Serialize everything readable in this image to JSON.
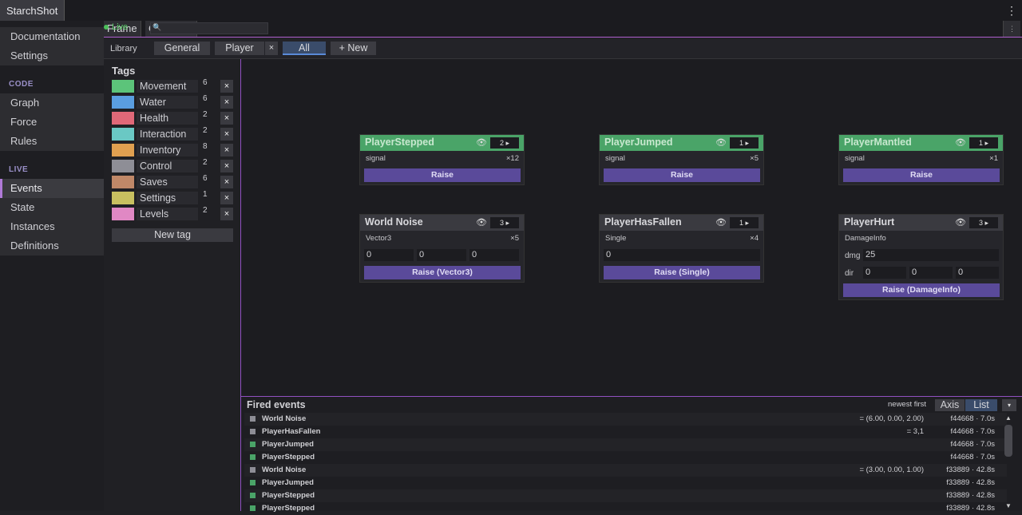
{
  "app": {
    "title": "StarchShot",
    "menu_icon": "⋮"
  },
  "sidebar": {
    "top_items": [
      {
        "label": "Documentation"
      },
      {
        "label": "Settings"
      }
    ],
    "code_header": "CODE",
    "code_items": [
      {
        "label": "Graph"
      },
      {
        "label": "Force"
      },
      {
        "label": "Rules"
      }
    ],
    "live_header": "LIVE",
    "live_items": [
      {
        "label": "Events",
        "active": true
      },
      {
        "label": "State"
      },
      {
        "label": "Instances"
      },
      {
        "label": "Definitions"
      }
    ]
  },
  "toolbar": {
    "frame_label": "Frame",
    "clear_log_label": "Clear Log",
    "live_label": "Live",
    "search_icon": "🔍",
    "search_placeholder": "",
    "menu_icon": "⋮"
  },
  "library": {
    "label": "Library",
    "tabs": [
      {
        "label": "General"
      },
      {
        "label": "Player"
      },
      {
        "label": "All",
        "active": true
      }
    ],
    "close_icon": "×",
    "new_label": "+ New"
  },
  "tags": {
    "title": "Tags",
    "items": [
      {
        "name": "Movement",
        "count": "6",
        "color": "#5cc47a"
      },
      {
        "name": "Water",
        "count": "6",
        "color": "#5a9ee0"
      },
      {
        "name": "Health",
        "count": "2",
        "color": "#e06878"
      },
      {
        "name": "Interaction",
        "count": "2",
        "color": "#6ac8c4"
      },
      {
        "name": "Inventory",
        "count": "8",
        "color": "#e0a050"
      },
      {
        "name": "Control",
        "count": "2",
        "color": "#8e8e96"
      },
      {
        "name": "Saves",
        "count": "6",
        "color": "#c08868"
      },
      {
        "name": "Settings",
        "count": "1",
        "color": "#c8c060"
      },
      {
        "name": "Levels",
        "count": "2",
        "color": "#e088c4"
      }
    ],
    "remove_icon": "×",
    "new_tag_label": "New tag"
  },
  "cards": [
    {
      "title": "PlayerStepped",
      "badge": "2 ▸",
      "type": "signal",
      "count": "×12",
      "raise": "Raise",
      "head_color": "#4aa468",
      "title_color": "#c8e8cf"
    },
    {
      "title": "PlayerJumped",
      "badge": "1 ▸",
      "type": "signal",
      "count": "×5",
      "raise": "Raise",
      "head_color": "#4aa468",
      "title_color": "#c8e8cf"
    },
    {
      "title": "PlayerMantled",
      "badge": "1 ▸",
      "type": "signal",
      "count": "×1",
      "raise": "Raise",
      "head_color": "#4aa468",
      "title_color": "#c8e8cf"
    },
    {
      "title": "World Noise",
      "badge": "3 ▸",
      "type": "Vector3",
      "count": "×5",
      "raise": "Raise (Vector3)",
      "head_color": "#3a3a40",
      "title_color": "#d8d8dc",
      "fields": [
        "0",
        "0",
        "0"
      ]
    },
    {
      "title": "PlayerHasFallen",
      "badge": "1 ▸",
      "type": "Single",
      "count": "×4",
      "raise": "Raise (Single)",
      "head_color": "#3a3a40",
      "title_color": "#d8d8dc",
      "fields": [
        "0"
      ]
    },
    {
      "title": "PlayerHurt",
      "badge": "3 ▸",
      "type": "DamageInfo",
      "count": "",
      "raise": "Raise (DamageInfo)",
      "head_color": "#3a3a40",
      "title_color": "#d8d8dc",
      "dmg_label": "dmg",
      "dmg_value": "25",
      "dir_label": "dir",
      "dir_values": [
        "0",
        "0",
        "0"
      ]
    }
  ],
  "eye_icon": "👁",
  "log": {
    "title": "Fired events",
    "order": "newest first",
    "axis_label": "Axis",
    "list_label": "List",
    "dropdown_icon": "▾",
    "scroll_up_icon": "▲",
    "scroll_down_icon": "▼",
    "rows": [
      {
        "name": "World Noise",
        "value": "= (6.00, 0.00, 2.00)",
        "time": "f44668 · 7.0s",
        "color": "#8e8e96"
      },
      {
        "name": "PlayerHasFallen",
        "value": "= 3,1",
        "time": "f44668 · 7.0s",
        "color": "#8e8e96"
      },
      {
        "name": "PlayerJumped",
        "value": "",
        "time": "f44668 · 7.0s",
        "color": "#4aa468"
      },
      {
        "name": "PlayerStepped",
        "value": "",
        "time": "f44668 · 7.0s",
        "color": "#4aa468"
      },
      {
        "name": "World Noise",
        "value": "= (3.00, 0.00, 1.00)",
        "time": "f33889 · 42.8s",
        "color": "#8e8e96"
      },
      {
        "name": "PlayerJumped",
        "value": "",
        "time": "f33889 · 42.8s",
        "color": "#4aa468"
      },
      {
        "name": "PlayerStepped",
        "value": "",
        "time": "f33889 · 42.8s",
        "color": "#4aa468"
      },
      {
        "name": "PlayerStepped",
        "value": "",
        "time": "f33889 · 42.8s",
        "color": "#4aa468"
      }
    ]
  }
}
